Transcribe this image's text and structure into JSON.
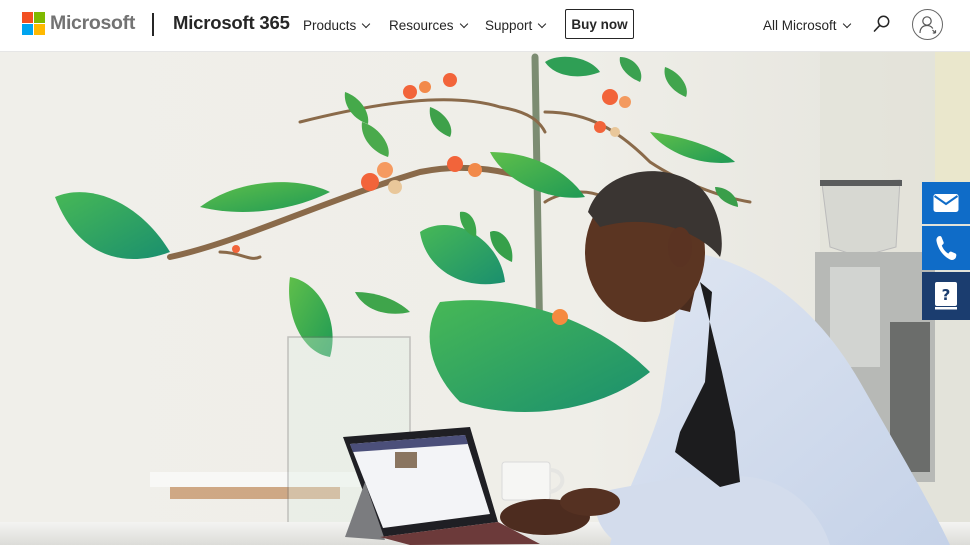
{
  "header": {
    "brand": "Microsoft",
    "product": "Microsoft 365",
    "nav": [
      {
        "label": "Products",
        "has_dropdown": true
      },
      {
        "label": "Resources",
        "has_dropdown": true
      },
      {
        "label": "Support",
        "has_dropdown": true
      }
    ],
    "cta_label": "Buy now",
    "all_microsoft_label": "All Microsoft",
    "icons": {
      "search": "search-icon",
      "account": "account-icon"
    }
  },
  "hero": {
    "image_description": "Man in light blue shirt and black apron smiling while typing on a Surface tablet at a cafe counter, with a painted coffee-plant mural on the wall behind him"
  },
  "contact_bar": {
    "items": [
      {
        "name": "email",
        "icon": "mail-icon",
        "color": "#0f6cc8"
      },
      {
        "name": "phone",
        "icon": "phone-icon",
        "color": "#0f6cc8"
      },
      {
        "name": "help",
        "icon": "help-book-icon",
        "color": "#1b3d6f"
      }
    ]
  },
  "colors": {
    "ms_red": "#f25022",
    "ms_green": "#7fba00",
    "ms_blue": "#00a4ef",
    "ms_yellow": "#ffb900",
    "text_dark": "#262626",
    "logo_gray": "#737373"
  }
}
